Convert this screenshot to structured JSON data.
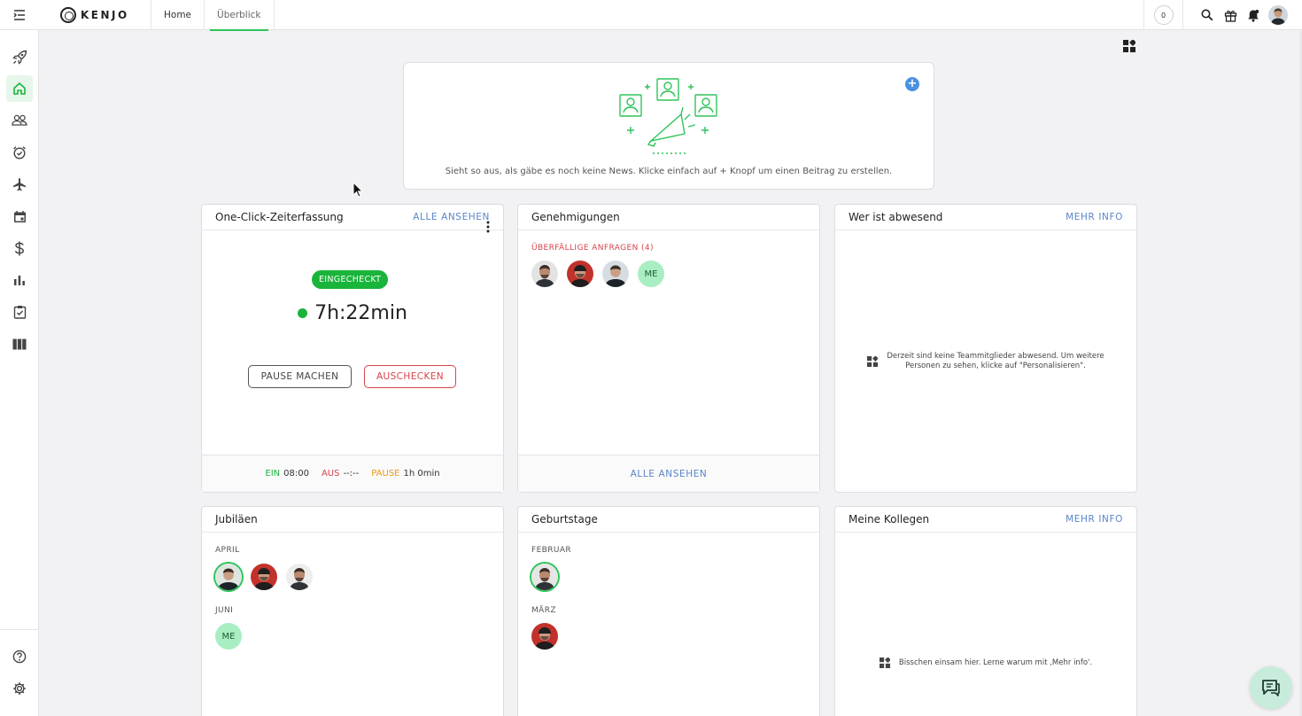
{
  "app": {
    "logo_text": "KENJO"
  },
  "topnav": {
    "tabs": [
      {
        "label": "Home"
      },
      {
        "label": "Überblick"
      }
    ]
  },
  "topbar": {
    "notification_count": "0"
  },
  "news": {
    "empty_text": "Sieht so aus, als gäbe es noch keine News. Klicke einfach auf + Knopf um einen Beitrag zu erstellen.",
    "add_label": "+"
  },
  "time_tracking": {
    "title": "One-Click-Zeiterfassung",
    "link": "ALLE ANSEHEN",
    "status": "EINGECHECKT",
    "timer": "7h:22min",
    "pause_button": "PAUSE MACHEN",
    "checkout_button": "AUSCHECKEN",
    "footer": {
      "in_label": "EIN",
      "in_value": "08:00",
      "out_label": "AUS",
      "out_value": "--:--",
      "pause_label": "PAUSE",
      "pause_value": "1h 0min"
    }
  },
  "approvals": {
    "title": "Genehmigungen",
    "overdue_label": "ÜBERFÄLLIGE ANFRAGEN (4)",
    "me_initials": "ME",
    "footer_link": "ALLE ANSEHEN"
  },
  "absent": {
    "title": "Wer ist abwesend",
    "link": "MEHR INFO",
    "empty_line1": "Derzeit sind keine Teammitglieder abwesend. Um weitere",
    "empty_line2": "Personen zu sehen, klicke auf \"Personalisieren\"."
  },
  "anniversaries": {
    "title": "Jubiläen",
    "month1": "APRIL",
    "month2": "JUNI",
    "me_initials": "ME"
  },
  "birthdays": {
    "title": "Geburtstage",
    "month1": "FEBRUAR",
    "month2": "MÄRZ"
  },
  "colleagues": {
    "title": "Meine Kollegen",
    "link": "MEHR INFO",
    "empty_text": "Bisschen einsam hier. Lerne warum mit ‚Mehr info'."
  },
  "colors": {
    "accent": "#2ec45b",
    "checked_in": "#19b43a",
    "danger": "#d9434b",
    "pause": "#e89a1a",
    "link": "#5a86c8",
    "add": "#4a90e2"
  }
}
